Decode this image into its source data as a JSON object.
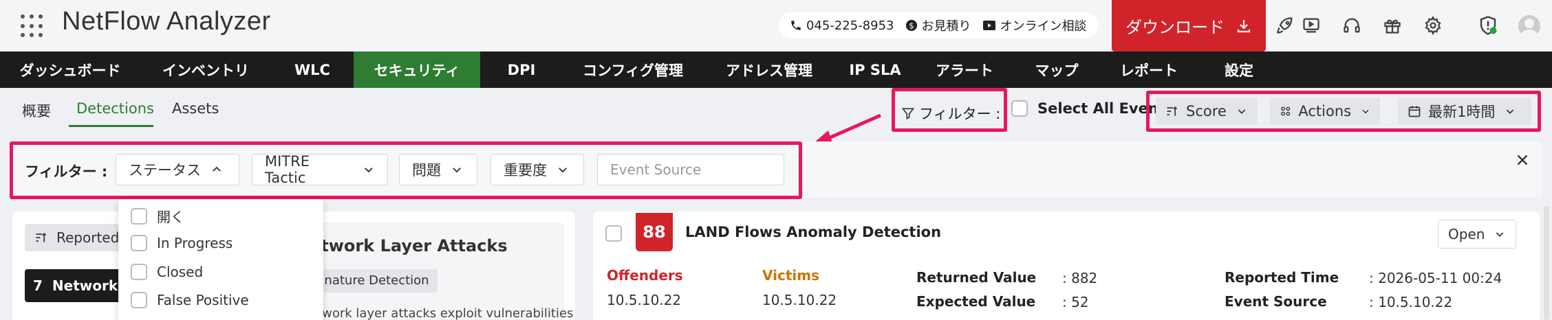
{
  "header": {
    "app_title": "NetFlow Analyzer",
    "phone": "045-225-8953",
    "quote": "お見積り",
    "consult": "オンライン相談",
    "download": "ダウンロード"
  },
  "nav": [
    {
      "label": "ダッシュボード"
    },
    {
      "label": "インベントリ"
    },
    {
      "label": "WLC"
    },
    {
      "label": "セキュリティ",
      "active": true
    },
    {
      "label": "DPI"
    },
    {
      "label": "コンフィグ管理"
    },
    {
      "label": "アドレス管理"
    },
    {
      "label": "IP SLA"
    },
    {
      "label": "アラート"
    },
    {
      "label": "マップ"
    },
    {
      "label": "レポート"
    },
    {
      "label": "設定"
    }
  ],
  "subtabs": [
    "概要",
    "Detections",
    "Assets"
  ],
  "toolbar": {
    "filter_label": "フィルター :",
    "select_all": "Select All Events",
    "score": "Score",
    "actions": "Actions",
    "time_range": "最新1時間"
  },
  "filters": {
    "label": "フィルター :",
    "status": "ステータス",
    "mitre": "MITRE Tactic",
    "problem": "問題",
    "severity": "重要度",
    "event_source_placeholder": "Event Source"
  },
  "status_options": [
    "開く",
    "In Progress",
    "Closed",
    "False Positive"
  ],
  "left": {
    "reported_btn": "Reported",
    "tile_count": "7",
    "tile_label": "Network L",
    "attack_title": "etwork Layer Attacks",
    "tag": "gnature Detection",
    "desc": "etwork layer attacks exploit vulnerabilities"
  },
  "event": {
    "score": "88",
    "title": "LAND Flows Anomaly Detection",
    "status": "Open",
    "offenders_label": "Offenders",
    "offenders_value": "10.5.10.22",
    "victims_label": "Victims",
    "victims_value": "10.5.10.22",
    "returned_label": "Returned Value",
    "returned_value": ": 882",
    "expected_label": "Expected Value",
    "expected_value": ": 52",
    "reported_label": "Reported Time",
    "reported_value": ": 2026-05-11 00:24",
    "source_label": "Event Source",
    "source_value": ": 10.5.10.22"
  },
  "colors": {
    "brand_red": "#d1232a",
    "nav_active": "#2e7d32",
    "highlight": "#e8175d"
  }
}
